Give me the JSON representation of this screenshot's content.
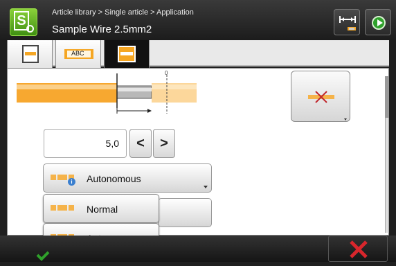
{
  "header": {
    "breadcrumb": "Article library > Single article > Application",
    "title": "Sample Wire 2.5mm2"
  },
  "tabs": [
    {
      "icon": "single-wire-icon"
    },
    {
      "label": "ABC"
    },
    {
      "icon": "wire-end-icon",
      "active": true
    }
  ],
  "diagram": {
    "zero_label": "0"
  },
  "value_field": {
    "value": "5,0"
  },
  "stepper": {
    "decrease": "<",
    "increase": ">"
  },
  "processing_mode": {
    "selected": "Autonomous",
    "options": [
      "Normal",
      "Autonomous"
    ]
  },
  "colors": {
    "accent_orange": "#f5a623",
    "ok_green": "#2fa12b",
    "cancel_red": "#d8262c"
  }
}
